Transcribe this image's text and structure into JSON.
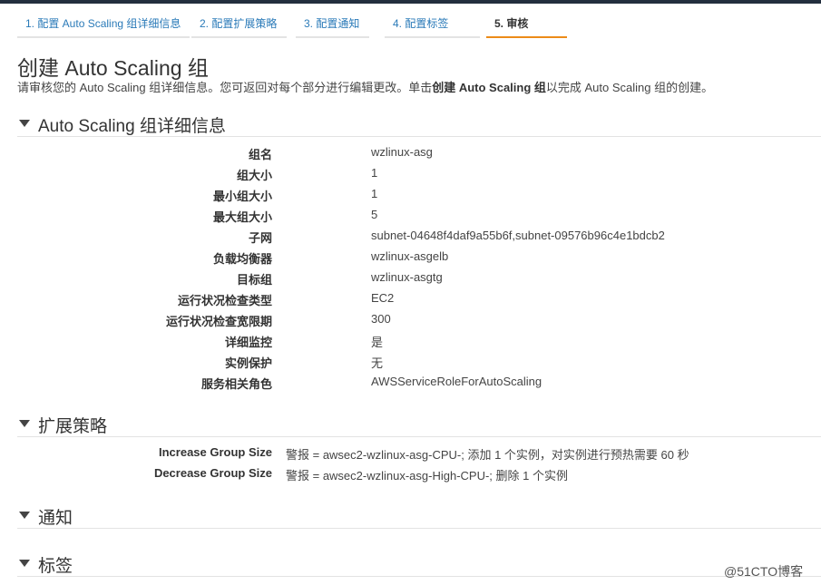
{
  "wizard": {
    "tabs": [
      {
        "label": "1. 配置 Auto Scaling 组详细信息"
      },
      {
        "label": "2. 配置扩展策略"
      },
      {
        "label": "3. 配置通知"
      },
      {
        "label": "4. 配置标签"
      },
      {
        "label": "5. 审核",
        "active": true
      }
    ]
  },
  "page": {
    "title": "创建 Auto Scaling 组",
    "intro_prefix": "请审核您的 Auto Scaling 组详细信息。您可返回对每个部分进行编辑更改。单击",
    "intro_bold": "创建 Auto Scaling 组",
    "intro_suffix": "以完成 Auto Scaling 组的创建。"
  },
  "details": {
    "header": "Auto Scaling 组详细信息",
    "rows": [
      {
        "label": "组名",
        "value": "wzlinux-asg"
      },
      {
        "label": "组大小",
        "value": "1"
      },
      {
        "label": "最小组大小",
        "value": "1"
      },
      {
        "label": "最大组大小",
        "value": "5"
      },
      {
        "label": "子网",
        "value": "subnet-04648f4daf9a55b6f,subnet-09576b96c4e1bdcb2"
      },
      {
        "label": "负载均衡器",
        "value": "wzlinux-asgelb"
      },
      {
        "label": "目标组",
        "value": "wzlinux-asgtg"
      },
      {
        "label": "运行状况检查类型",
        "value": "EC2"
      },
      {
        "label": "运行状况检查宽限期",
        "value": "300"
      },
      {
        "label": "详细监控",
        "value": "是"
      },
      {
        "label": "实例保护",
        "value": "无"
      },
      {
        "label": "服务相关角色",
        "value": "AWSServiceRoleForAutoScaling"
      }
    ]
  },
  "policies": {
    "header": "扩展策略",
    "rows": [
      {
        "label": "Increase Group Size",
        "value": "警报 = awsec2-wzlinux-asg-CPU-; 添加 1 个实例，对实例进行预热需要 60 秒"
      },
      {
        "label": "Decrease Group Size",
        "value": "警报 = awsec2-wzlinux-asg-High-CPU-; 删除 1 个实例"
      }
    ]
  },
  "notifications": {
    "header": "通知"
  },
  "tags": {
    "header": "标签"
  },
  "watermark": "@51CTO博客",
  "colors": {
    "link": "#2a7ab8",
    "active_tab_underline": "#ec8b18",
    "topbar": "#232f3e"
  }
}
